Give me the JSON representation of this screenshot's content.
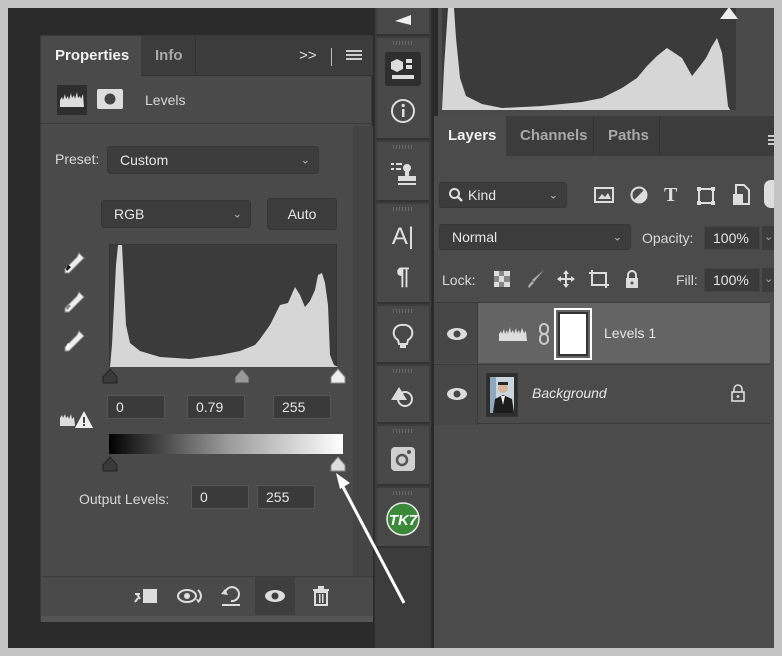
{
  "properties_panel": {
    "tabs": [
      {
        "label": "Properties",
        "active": true
      },
      {
        "label": "Info",
        "active": false
      }
    ],
    "overflow_icon": ">>",
    "title": "Levels",
    "preset_label": "Preset:",
    "preset_value": "Custom",
    "channel_value": "RGB",
    "auto_label": "Auto",
    "input_levels": {
      "black": "0",
      "gamma": "0.79",
      "white": "255"
    },
    "output_label": "Output Levels:",
    "output_levels": {
      "black": "0",
      "white": "255"
    },
    "bottom_icons": [
      "clip-to-layer-icon",
      "view-previous-state-icon",
      "reset-icon",
      "visibility-icon",
      "delete-icon"
    ]
  },
  "toolbar": {
    "icons": [
      "play-icon",
      "properties-cube-icon",
      "info-icon",
      "clone-source-icon",
      "character-icon",
      "paragraph-icon",
      "lightbulb-icon",
      "shapes-icon",
      "instagram-icon",
      "tk7-plugin-icon"
    ],
    "tk7_label": "TK7"
  },
  "layers_panel": {
    "tabs": [
      {
        "label": "Layers",
        "active": true
      },
      {
        "label": "Channels",
        "active": false
      },
      {
        "label": "Paths",
        "active": false
      }
    ],
    "filter_value": "Kind",
    "blend_mode": "Normal",
    "opacity_label": "Opacity:",
    "opacity_value": "100%",
    "lock_label": "Lock:",
    "fill_label": "Fill:",
    "fill_value": "100%",
    "layers": [
      {
        "name": "Levels 1",
        "type": "adjustment",
        "visible": true,
        "selected": true
      },
      {
        "name": "Background",
        "type": "image",
        "visible": true,
        "locked": true
      }
    ]
  },
  "colors": {
    "panel": "#4a4a4a",
    "dark": "#2a2a2a",
    "accent_green": "#3a8a3a"
  }
}
